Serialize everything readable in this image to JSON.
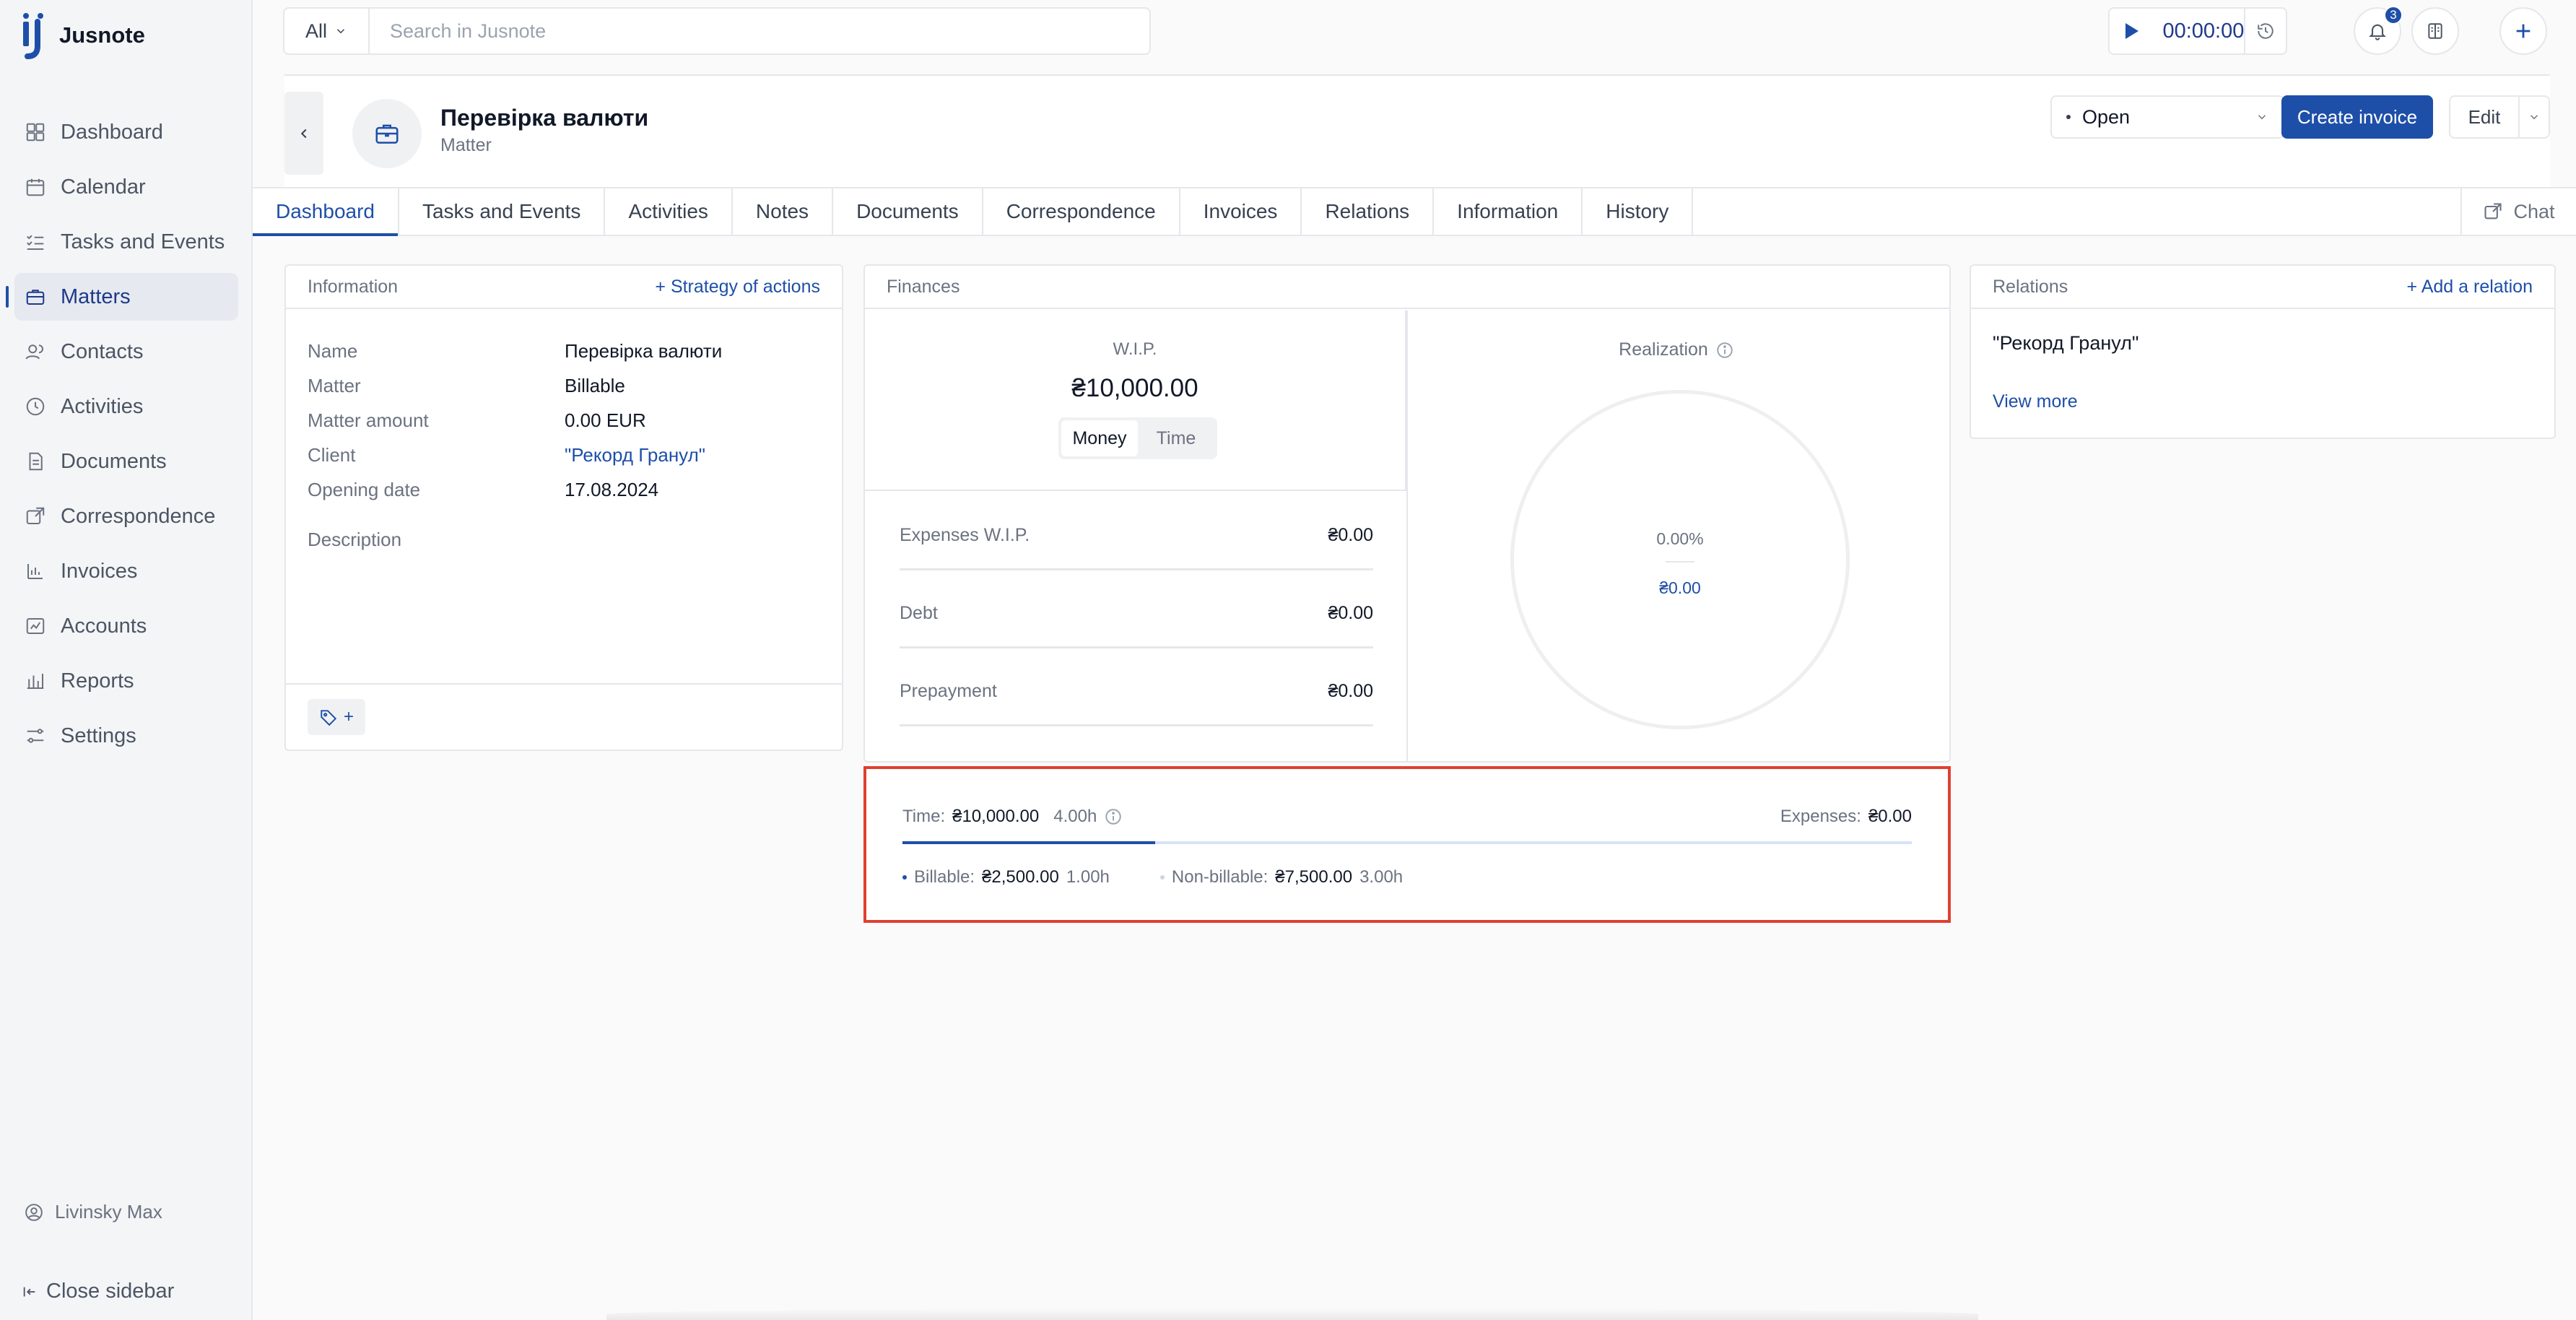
{
  "app": {
    "name": "Jusnote"
  },
  "sidebar": {
    "items": [
      {
        "label": "Dashboard",
        "icon": "dashboard-icon"
      },
      {
        "label": "Calendar",
        "icon": "calendar-icon"
      },
      {
        "label": "Tasks and Events",
        "icon": "tasks-icon"
      },
      {
        "label": "Matters",
        "icon": "briefcase-icon",
        "active": true
      },
      {
        "label": "Contacts",
        "icon": "contacts-icon"
      },
      {
        "label": "Activities",
        "icon": "clock-icon"
      },
      {
        "label": "Documents",
        "icon": "documents-icon"
      },
      {
        "label": "Correspondence",
        "icon": "correspondence-icon"
      },
      {
        "label": "Invoices",
        "icon": "invoices-icon"
      },
      {
        "label": "Accounts",
        "icon": "accounts-icon"
      },
      {
        "label": "Reports",
        "icon": "reports-icon"
      },
      {
        "label": "Settings",
        "icon": "settings-icon"
      }
    ],
    "user": "Livinsky Max",
    "close_label": "Close sidebar"
  },
  "topbar": {
    "search_scope": "All",
    "search_placeholder": "Search in Jusnote",
    "timer": "00:00:00",
    "notifications_count": "3"
  },
  "matter": {
    "title": "Перевірка валюти",
    "subtitle": "Matter",
    "status": "Open",
    "create_invoice_label": "Create invoice",
    "edit_label": "Edit"
  },
  "tabs": [
    "Dashboard",
    "Tasks and Events",
    "Activities",
    "Notes",
    "Documents",
    "Correspondence",
    "Invoices",
    "Relations",
    "Information",
    "History"
  ],
  "chat_label": "Chat",
  "information": {
    "title": "Information",
    "action": "Strategy of actions",
    "rows": [
      {
        "key": "Name",
        "value": "Перевірка валюти"
      },
      {
        "key": "Matter",
        "value": "Billable"
      },
      {
        "key": "Matter amount",
        "value": "0.00 EUR"
      },
      {
        "key": "Client",
        "value": "\"Рекорд Гранул\""
      },
      {
        "key": "Opening date",
        "value": "17.08.2024"
      }
    ],
    "description_label": "Description",
    "tag_add": "+"
  },
  "finances": {
    "title": "Finances",
    "wip_label": "W.I.P.",
    "wip_value": "₴10,000.00",
    "toggle": [
      "Money",
      "Time"
    ],
    "items": [
      {
        "label": "Expenses W.I.P.",
        "value": "₴0.00"
      },
      {
        "label": "Debt",
        "value": "₴0.00"
      },
      {
        "label": "Prepayment",
        "value": "₴0.00"
      }
    ],
    "realization_label": "Realization",
    "realization_pct": "0.00%",
    "realization_amount": "₴0.00",
    "time_label": "Time:",
    "time_value": "₴10,000.00",
    "time_hours": "4.00h",
    "expenses_label": "Expenses:",
    "expenses_value": "₴0.00",
    "billable_fraction": 0.25,
    "billable_label": "Billable:",
    "billable_value": "₴2,500.00",
    "billable_hours": "1.00h",
    "nonbillable_label": "Non-billable:",
    "nonbillable_value": "₴7,500.00",
    "nonbillable_hours": "3.00h"
  },
  "relations": {
    "title": "Relations",
    "action": "Add a relation",
    "client": "\"Рекорд Гранул\"",
    "view_more": "View more"
  },
  "colors": {
    "accent": "#1e4fa8",
    "highlight": "#e04030"
  }
}
